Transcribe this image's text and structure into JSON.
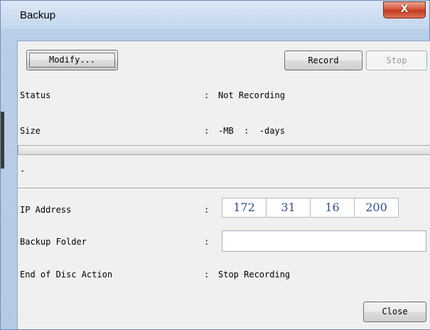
{
  "window": {
    "title": "Backup",
    "close_glyph": "X"
  },
  "toolbar": {
    "modify_label": "Modify...",
    "record_label": "Record",
    "stop_label": "Stop"
  },
  "status": {
    "label": "Status",
    "colon": ":",
    "value": "Not Recording"
  },
  "size": {
    "label": "Size",
    "colon": ":",
    "value": "-MB  :  -days"
  },
  "progress": {
    "value": 0
  },
  "message": "-",
  "ip_address": {
    "label": "IP Address",
    "colon": ":",
    "octets": [
      "172",
      "31",
      "16",
      "200"
    ]
  },
  "backup_folder": {
    "label": "Backup Folder",
    "colon": ":",
    "value": ""
  },
  "end_of_disc_action": {
    "label": "End of Disc Action",
    "colon": ":",
    "value": "Stop Recording"
  },
  "footer": {
    "close_label": "Close"
  },
  "colors": {
    "ip_text": "#2f4f8f",
    "title_bar": "#c9dcf0",
    "close_button": "#c23a1c"
  },
  "icons": {
    "close": "close-icon"
  }
}
